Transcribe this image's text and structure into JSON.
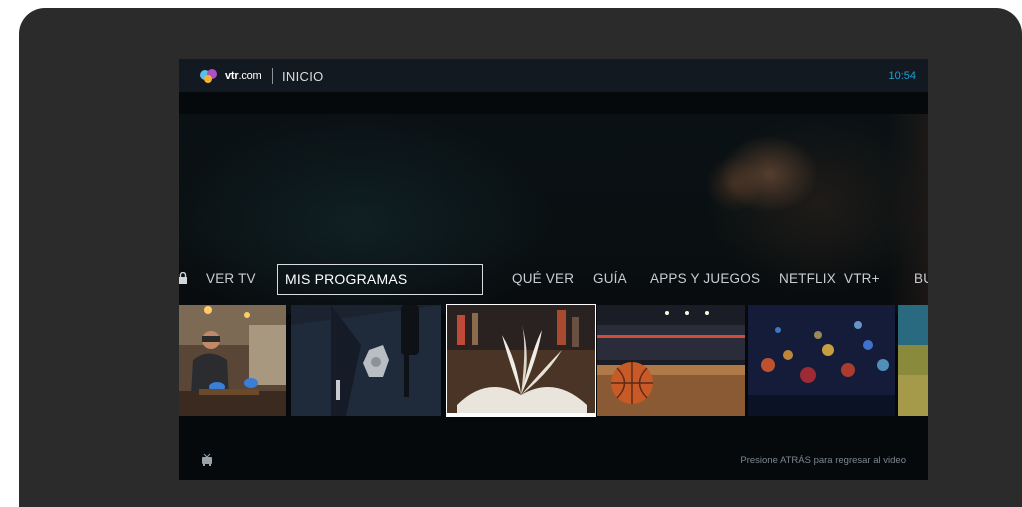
{
  "header": {
    "logo_text_bold": "vtr",
    "logo_text_rest": ".com",
    "section_title": "INICIO",
    "clock": "10:54"
  },
  "nav": {
    "items": [
      {
        "label": "VER TV"
      },
      {
        "label": "MIS PROGRAMAS",
        "selected": true
      },
      {
        "label": "QUÉ VER"
      },
      {
        "label": "GUÍA"
      },
      {
        "label": "APPS Y JUEGOS"
      },
      {
        "label": "NETFLIX"
      },
      {
        "label": "VTR+"
      },
      {
        "label": "BU"
      }
    ]
  },
  "tiles": [
    {
      "name": "chef-thumbnail"
    },
    {
      "name": "police-officer-thumbnail"
    },
    {
      "name": "open-book-thumbnail",
      "selected": true
    },
    {
      "name": "basketball-thumbnail"
    },
    {
      "name": "city-lights-thumbnail"
    },
    {
      "name": "field-thumbnail"
    }
  ],
  "footer": {
    "hint": "Presione ATRÁS para regresar al video",
    "icon": "tv-icon"
  },
  "colors": {
    "accent": "#1e9fd8",
    "bezel": "#2b2b2b",
    "screen_bg": "#06090c"
  }
}
